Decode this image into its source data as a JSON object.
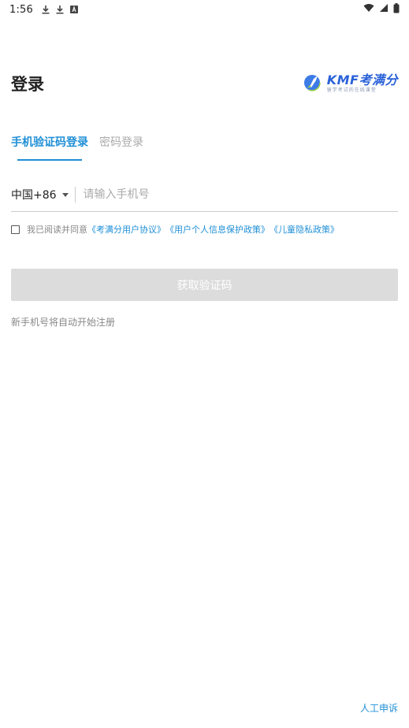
{
  "status_bar": {
    "time": "1:56",
    "icons_left": [
      "download-icon",
      "download-icon",
      "font-a-icon"
    ],
    "icons_right": [
      "wifi-icon",
      "signal-icon",
      "battery-icon"
    ]
  },
  "header": {
    "title": "登录",
    "brand_name": "KMF考满分",
    "brand_sub": "留学考试的在线课堂"
  },
  "tabs": [
    {
      "label": "手机验证码登录",
      "active": true
    },
    {
      "label": "密码登录",
      "active": false
    }
  ],
  "phone": {
    "country_code": "中国+86",
    "placeholder": "请输入手机号",
    "value": ""
  },
  "agreement": {
    "checked": false,
    "prefix": "我已阅读并同意",
    "links": [
      "《考满分用户协议》",
      "《用户个人信息保护政策》",
      "《儿童隐私政策》"
    ]
  },
  "button": {
    "label": "获取验证码"
  },
  "hint": "新手机号将自动开始注册",
  "appeal": "人工申诉",
  "colors": {
    "accent": "#1f8fd6",
    "brand": "#2b62d9",
    "button_disabled": "#dcdcdc"
  }
}
